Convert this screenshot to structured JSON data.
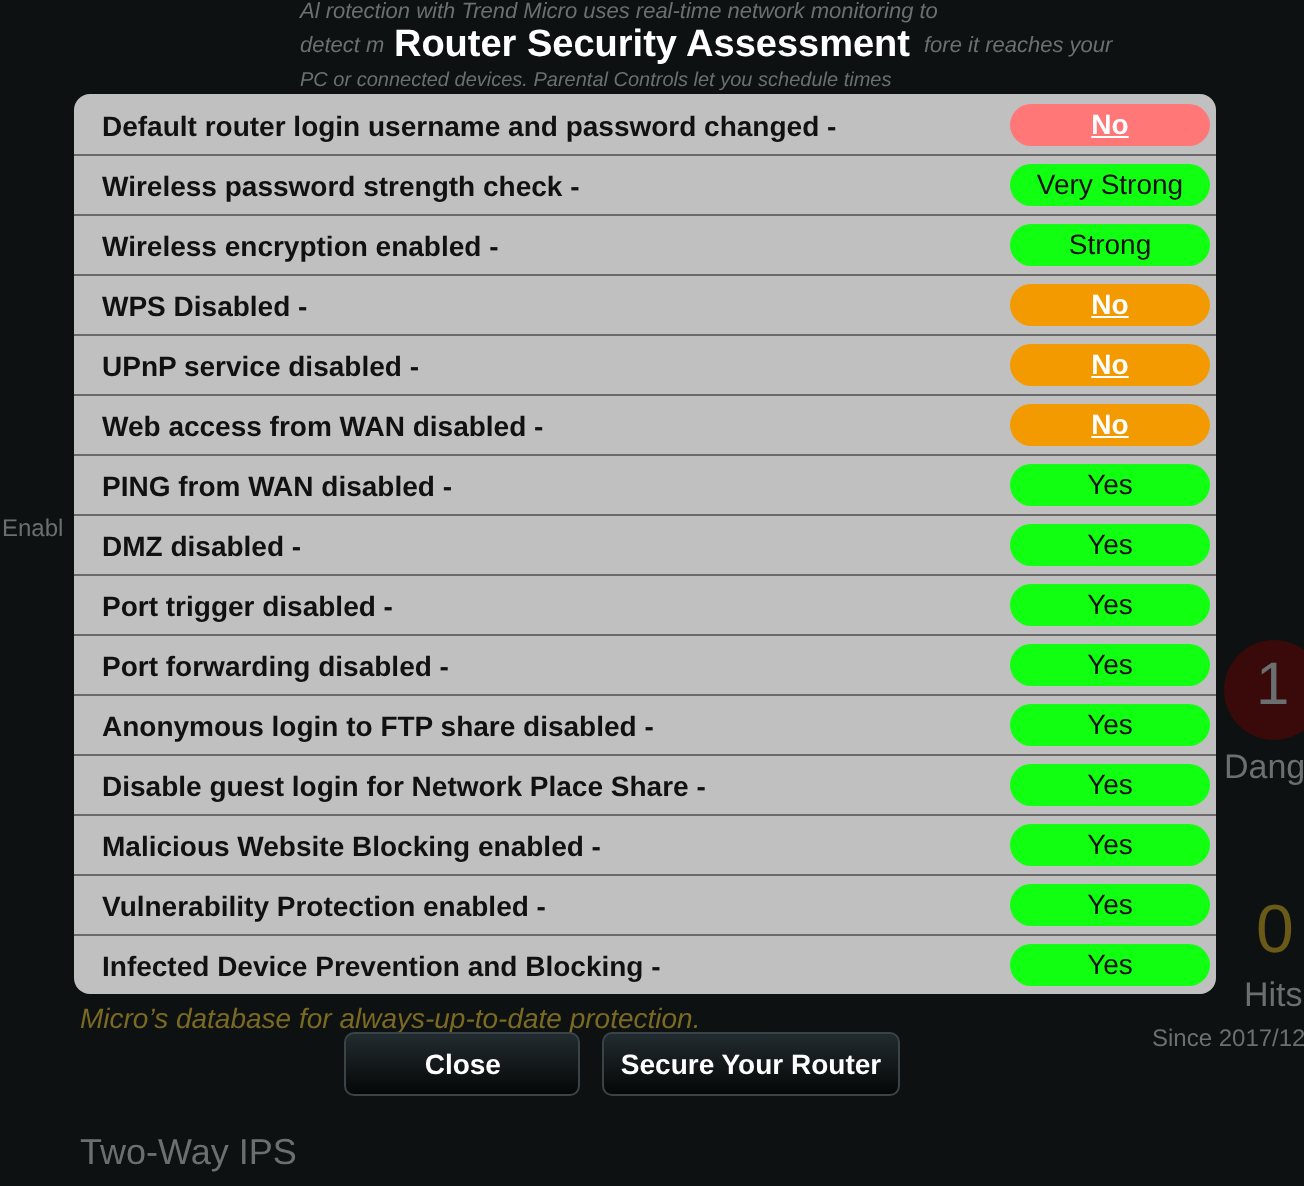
{
  "background": {
    "paragraph_lines": [
      "Al rotection with Trend Micro uses real-time network monitoring to",
      "detect m",
      "fore it reaches your",
      "PC or connected devices. Parental Controls let you schedule times"
    ],
    "enable_label": "Enabl",
    "danger_count": "1",
    "danger_label": "Dang",
    "hits_count": "0",
    "hits_label": "Hits",
    "since_label": "Since 2017/12",
    "database_note": "Micro’s database for always-up-to-date protection.",
    "section_title": "Two-Way IPS"
  },
  "dialog": {
    "title": "Router Security Assessment",
    "checks": [
      {
        "label": "Default router login username and password changed -",
        "result": "No",
        "color": "#ff7777",
        "link": true
      },
      {
        "label": "Wireless password strength check -",
        "result": "Very Strong",
        "color": "#11ff11",
        "link": false
      },
      {
        "label": "Wireless encryption enabled -",
        "result": "Strong",
        "color": "#11ff11",
        "link": false
      },
      {
        "label": "WPS Disabled -",
        "result": "No",
        "color": "#f39a00",
        "link": true
      },
      {
        "label": "UPnP service disabled -",
        "result": "No",
        "color": "#f39a00",
        "link": true
      },
      {
        "label": "Web access from WAN disabled -",
        "result": "No",
        "color": "#f39a00",
        "link": true
      },
      {
        "label": "PING from WAN disabled -",
        "result": "Yes",
        "color": "#11ff11",
        "link": false
      },
      {
        "label": "DMZ disabled -",
        "result": "Yes",
        "color": "#11ff11",
        "link": false
      },
      {
        "label": "Port trigger disabled -",
        "result": "Yes",
        "color": "#11ff11",
        "link": false
      },
      {
        "label": "Port forwarding disabled -",
        "result": "Yes",
        "color": "#11ff11",
        "link": false
      },
      {
        "label": "Anonymous login to FTP share disabled -",
        "result": "Yes",
        "color": "#11ff11",
        "link": false
      },
      {
        "label": "Disable guest login for Network Place Share -",
        "result": "Yes",
        "color": "#11ff11",
        "link": false
      },
      {
        "label": "Malicious Website Blocking enabled -",
        "result": "Yes",
        "color": "#11ff11",
        "link": false
      },
      {
        "label": "Vulnerability Protection enabled -",
        "result": "Yes",
        "color": "#11ff11",
        "link": false
      },
      {
        "label": "Infected Device Prevention and Blocking -",
        "result": "Yes",
        "color": "#11ff11",
        "link": false
      }
    ],
    "buttons": [
      "Close",
      "Secure Your Router"
    ]
  }
}
